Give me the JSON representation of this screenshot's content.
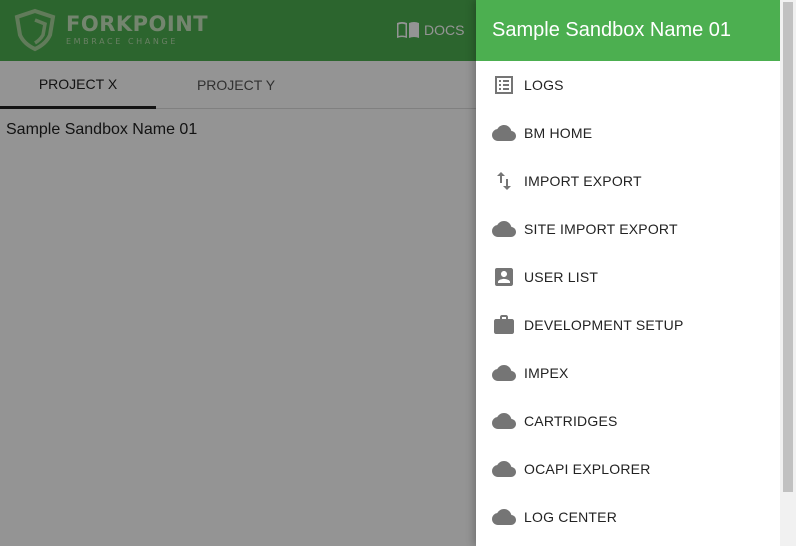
{
  "brand": {
    "name": "FORKPOINT",
    "tagline": "EMBRACE CHANGE"
  },
  "header": {
    "docs_label": "DOCS"
  },
  "tabs": [
    {
      "label": "PROJECT X",
      "active": true
    },
    {
      "label": "PROJECT Y",
      "active": false
    }
  ],
  "main": {
    "sandbox_name": "Sample Sandbox Name 01"
  },
  "drawer": {
    "title": "Sample Sandbox Name 01",
    "items": [
      {
        "label": "LOGS",
        "icon": "list-icon"
      },
      {
        "label": "BM HOME",
        "icon": "cloud-icon"
      },
      {
        "label": "IMPORT EXPORT",
        "icon": "swap-vert-icon"
      },
      {
        "label": "SITE IMPORT EXPORT",
        "icon": "cloud-icon"
      },
      {
        "label": "USER LIST",
        "icon": "account-box-icon"
      },
      {
        "label": "DEVELOPMENT SETUP",
        "icon": "briefcase-icon"
      },
      {
        "label": "IMPEX",
        "icon": "cloud-icon"
      },
      {
        "label": "CARTRIDGES",
        "icon": "cloud-icon"
      },
      {
        "label": "OCAPI EXPLORER",
        "icon": "cloud-icon"
      },
      {
        "label": "LOG CENTER",
        "icon": "cloud-icon"
      }
    ]
  },
  "colors": {
    "brand_green": "#4caf50",
    "icon_gray": "#757575"
  }
}
